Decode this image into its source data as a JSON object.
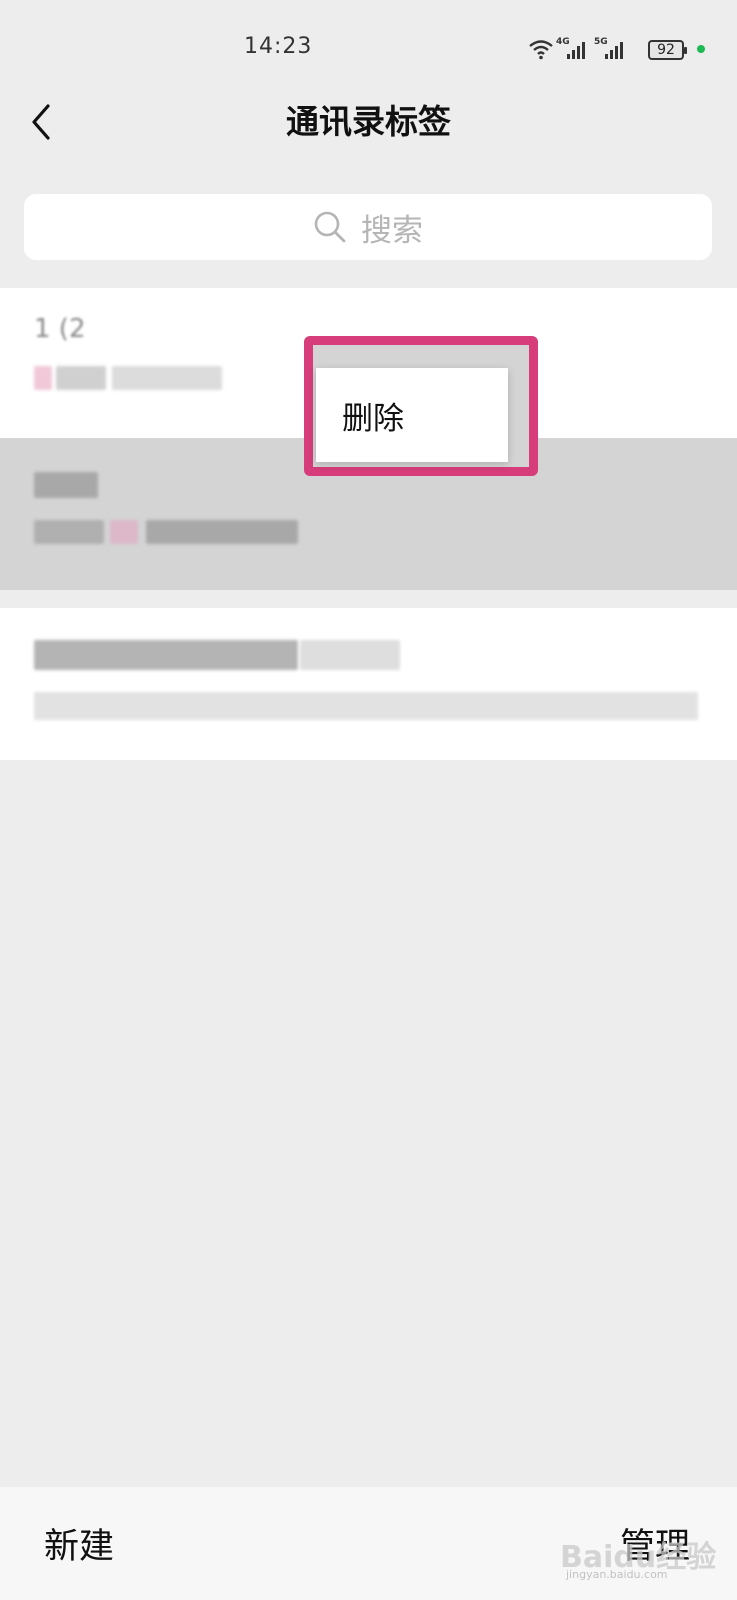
{
  "status_bar": {
    "time": "14:23",
    "net_1": "4G",
    "net_2": "5G",
    "battery": "92",
    "dot_color": "#1db954"
  },
  "nav": {
    "back_icon": "chevron-left-icon",
    "title": "通讯录标签"
  },
  "search": {
    "icon": "search-icon",
    "placeholder": "搜索"
  },
  "list": {
    "rows": [
      {
        "title_visible": "1 (2",
        "title_obscured": true,
        "subtitle_obscured": true,
        "selected": false
      },
      {
        "title_obscured": true,
        "subtitle_obscured": true,
        "selected": true
      },
      {
        "title_obscured": true,
        "subtitle_obscured": true,
        "selected": false
      }
    ]
  },
  "context_menu": {
    "delete_label": "删除",
    "highlight_color": "#d63d7a"
  },
  "bottom_bar": {
    "new_label": "新建",
    "manage_label": "管理"
  },
  "watermark": {
    "text": "Baidu经验",
    "sub": "jingyan.baidu.com"
  }
}
